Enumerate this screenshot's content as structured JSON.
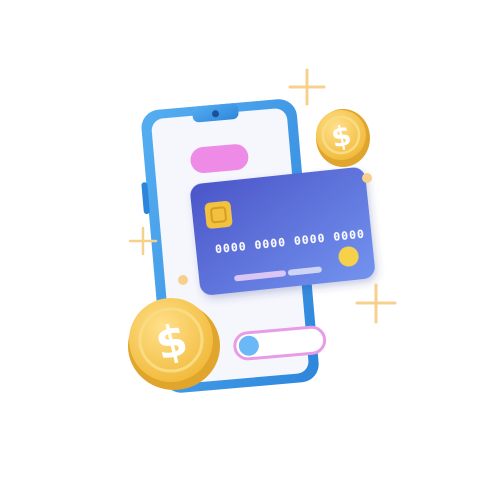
{
  "illustration": {
    "subject": "mobile payment",
    "colors": {
      "phone_frame": "#3d9ae6",
      "phone_screen": "#f6f7fd",
      "card_start": "#4a56c7",
      "card_end": "#6f8ff0",
      "chip": "#f2c13e",
      "pink_pill": "#ee8be6",
      "toggle_dot": "#6ab9f6",
      "toggle_outline": "#e89be6",
      "coin": "#f5c84a",
      "coin_shadow": "#e0a52c",
      "sparkle": "#f6d08c"
    }
  },
  "card": {
    "number": "0000 0000 0000 0000"
  },
  "coins": {
    "symbol": "$"
  }
}
